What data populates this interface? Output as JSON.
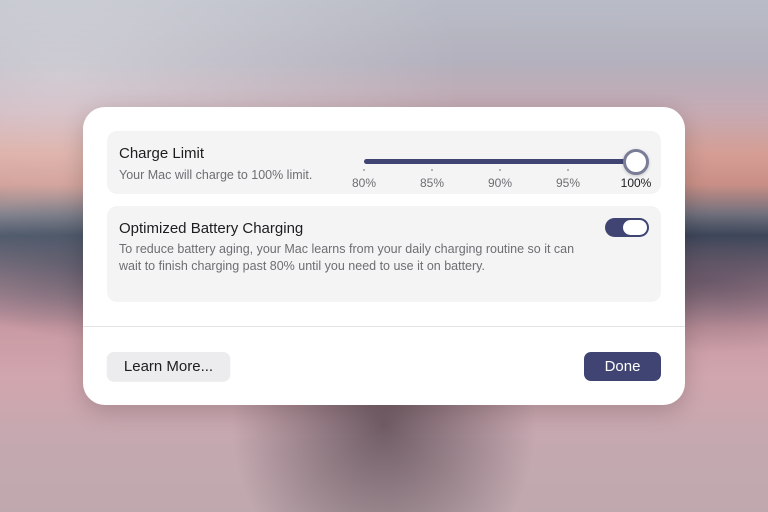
{
  "charge_limit": {
    "title": "Charge Limit",
    "subtitle": "Your Mac will charge to 100% limit.",
    "ticks": [
      "80%",
      "85%",
      "90%",
      "95%",
      "100%"
    ],
    "selected_percent": 100,
    "min_percent": 80,
    "max_percent": 100
  },
  "optimized_charging": {
    "title": "Optimized Battery Charging",
    "description": "To reduce battery aging, your Mac learns from your daily charging routine so it can wait to finish charging past 80% until you need to use it on battery.",
    "enabled": true
  },
  "buttons": {
    "learn_more": "Learn More...",
    "done": "Done"
  },
  "colors": {
    "accent": "#3f4472",
    "track": "#d7d7dc"
  }
}
